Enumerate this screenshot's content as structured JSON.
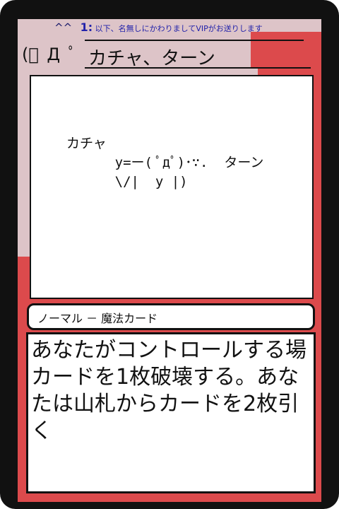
{
  "post_header": {
    "hats": "^^",
    "number": "1:",
    "name": "以下、名無しにかわりましてVIPがお送りします"
  },
  "card": {
    "face_deco": "(ﾟ Д ﾟ",
    "title": "カチャ、ターン",
    "art": "カチャ\n      y=ー( ﾟдﾟ)･∵.  ターン\n      \\/|  y |)",
    "type_line": "ノーマル － 魔法カード",
    "description": "あなたがコントロールする場カードを1枚破壊する。あなたは山札からカードを2枚引く"
  },
  "colors": {
    "frame": "#111111",
    "card_red": "#dc4a4c",
    "card_pink": "#ddc4c8",
    "header_text": "#2222aa"
  }
}
